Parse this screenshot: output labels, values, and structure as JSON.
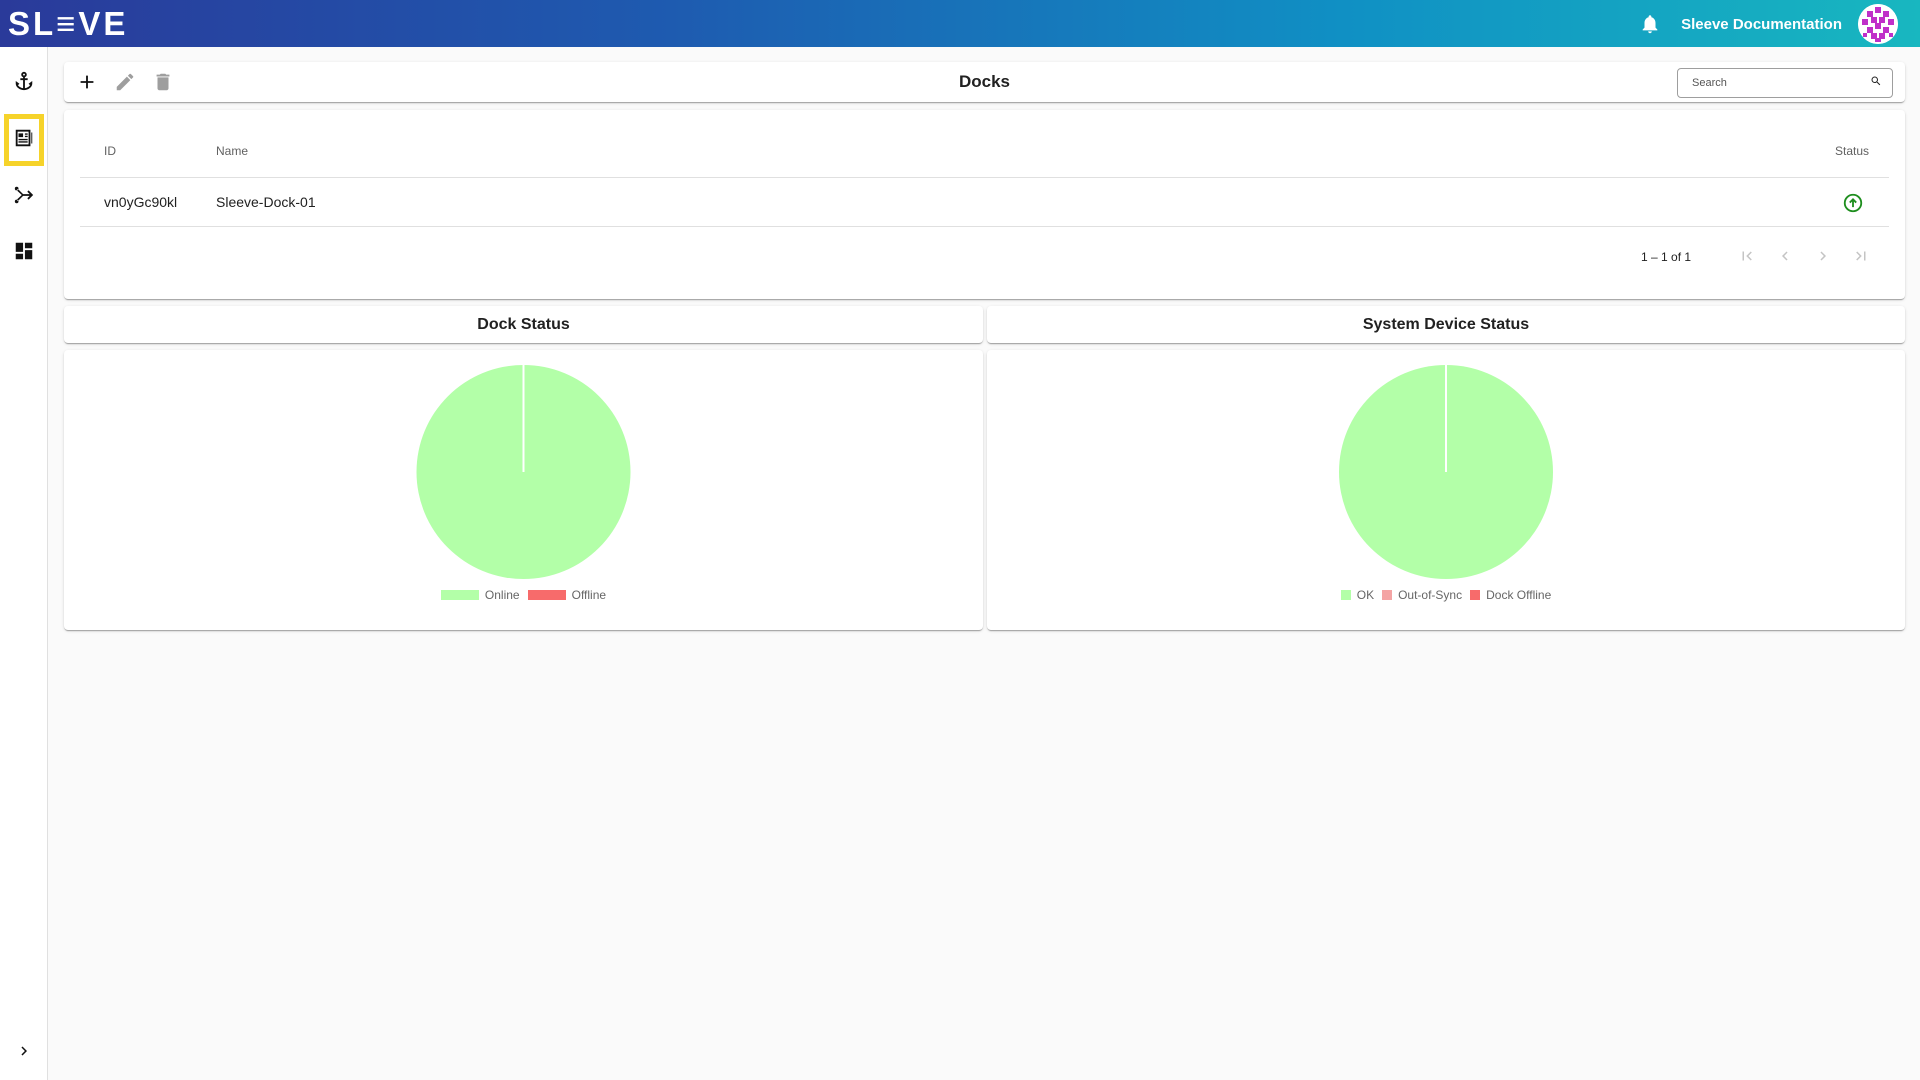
{
  "app": {
    "logo_text": "SL≡VE",
    "doc_link": "Sleeve Documentation"
  },
  "sidebar": {
    "items": [
      {
        "name": "anchor-icon",
        "active": false
      },
      {
        "name": "docks-list-icon",
        "active": true
      },
      {
        "name": "route-icon",
        "active": false
      },
      {
        "name": "dashboard-icon",
        "active": false
      }
    ]
  },
  "toolbar": {
    "title": "Docks",
    "search_placeholder": "Search"
  },
  "table": {
    "headers": {
      "id": "ID",
      "name": "Name",
      "status": "Status"
    },
    "rows": [
      {
        "id": "vn0yGc90kl",
        "name": "Sleeve-Dock-01",
        "status": "online"
      }
    ],
    "pagination": "1 – 1 of 1"
  },
  "colors": {
    "online": "#b3ffa8",
    "offline": "#f76b6b",
    "out_of_sync": "#f4a4a4",
    "status_ok": "#1e8e1e",
    "highlight": "#f6d32a"
  },
  "chart_data": [
    {
      "type": "pie",
      "title": "Dock Status",
      "categories": [
        "Online",
        "Offline"
      ],
      "values": [
        1,
        0
      ],
      "colors": [
        "#b3ffa8",
        "#f76b6b"
      ],
      "legend": "bottom"
    },
    {
      "type": "pie",
      "title": "System Device Status",
      "categories": [
        "OK",
        "Out-of-Sync",
        "Dock Offline"
      ],
      "values": [
        1,
        0,
        0
      ],
      "colors": [
        "#b3ffa8",
        "#f4a4a4",
        "#f76b6b"
      ],
      "legend": "bottom"
    }
  ]
}
